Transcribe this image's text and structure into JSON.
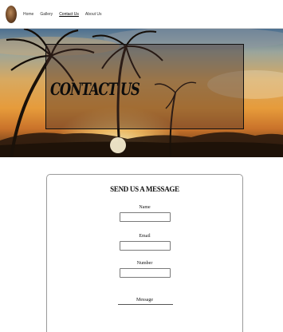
{
  "nav": {
    "links": [
      "Home",
      "Gallery",
      "Contact Us",
      "About Us"
    ]
  },
  "hero": {
    "title": "CONTACT US"
  },
  "form": {
    "title": "SEND US A MESSAGE",
    "fields": [
      {
        "label": "Name",
        "value": ""
      },
      {
        "label": "Email",
        "value": ""
      },
      {
        "label": "Number",
        "value": ""
      }
    ],
    "message_label": "Message"
  },
  "colors": {
    "page_background": "#ffffff",
    "hero_overlay": "#462d28",
    "field_border": "#7a7a7a"
  }
}
